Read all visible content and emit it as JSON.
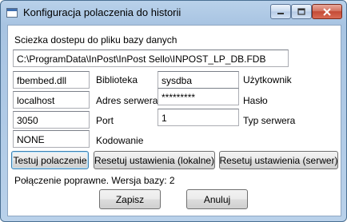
{
  "window": {
    "title": "Konfiguracja polaczenia do historii",
    "controls": [
      "minimize-icon",
      "maximize-icon",
      "close-icon"
    ]
  },
  "form": {
    "db_path_label": "Sciezka dostepu do pliku bazy danych",
    "db_path_value": "C:\\ProgramData\\InPost\\InPost Sello\\INPOST_LP_DB.FDB",
    "library_value": "fbembed.dll",
    "library_label": "Biblioteka",
    "user_value": "sysdba",
    "user_label": "Użytkownik",
    "server_value": "localhost",
    "server_label": "Adres serwera",
    "password_value": "*********",
    "password_label": "Hasło",
    "port_value": "3050",
    "port_label": "Port",
    "server_type_value": "1",
    "server_type_label": "Typ serwera",
    "encoding_value": "NONE",
    "encoding_label": "Kodowanie"
  },
  "buttons": {
    "test": "Testuj polaczenie",
    "reset_local": "Resetuj ustawienia (lokalne)",
    "reset_server": "Resetuj ustawienia (serwer)",
    "save": "Zapisz",
    "cancel": "Anuluj"
  },
  "status": "Połączenie poprawne. Wersja bazy: 2",
  "colors": {
    "title_bar": "#b9d1ea",
    "close_button": "#c44a36",
    "focus_border": "#3c7fb1"
  }
}
